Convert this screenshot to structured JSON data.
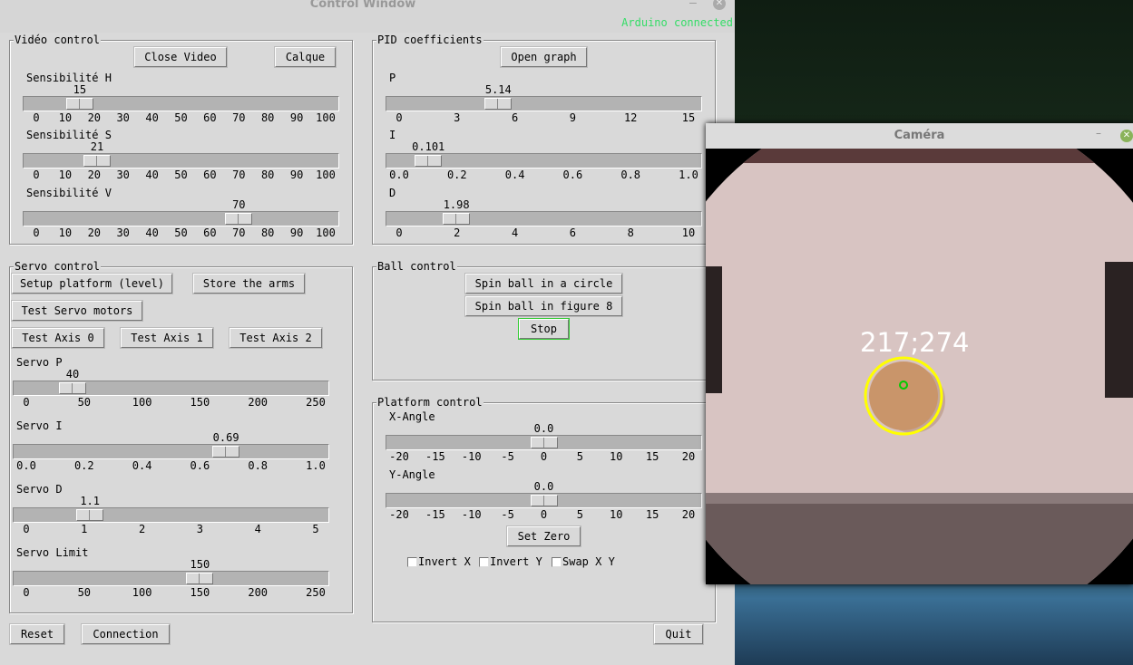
{
  "background": {
    "accent": "#33dd66"
  },
  "control_window": {
    "title": "Control Window",
    "status": "Arduino connected",
    "video": {
      "legend": "Vidéo control",
      "close_video": "Close Video",
      "calque": "Calque",
      "sliders": [
        {
          "label": "Sensibilité H",
          "value": 15,
          "display": "15",
          "min": 0,
          "max": 100,
          "ticks": [
            "0",
            "10",
            "20",
            "30",
            "40",
            "50",
            "60",
            "70",
            "80",
            "90",
            "100"
          ]
        },
        {
          "label": "Sensibilité S",
          "value": 21,
          "display": "21",
          "min": 0,
          "max": 100,
          "ticks": [
            "0",
            "10",
            "20",
            "30",
            "40",
            "50",
            "60",
            "70",
            "80",
            "90",
            "100"
          ]
        },
        {
          "label": "Sensibilité V",
          "value": 70,
          "display": "70",
          "min": 0,
          "max": 100,
          "ticks": [
            "0",
            "10",
            "20",
            "30",
            "40",
            "50",
            "60",
            "70",
            "80",
            "90",
            "100"
          ]
        }
      ]
    },
    "pid": {
      "legend": "PID coefficients",
      "open_graph": "Open graph",
      "sliders": [
        {
          "label": "P",
          "value": 5.14,
          "display": "5.14",
          "min": 0,
          "max": 15,
          "ticks": [
            "0",
            "3",
            "6",
            "9",
            "12",
            "15"
          ]
        },
        {
          "label": "I",
          "value": 0.101,
          "display": "0.101",
          "min": 0,
          "max": 1,
          "ticks": [
            "0.0",
            "0.2",
            "0.4",
            "0.6",
            "0.8",
            "1.0"
          ]
        },
        {
          "label": "D",
          "value": 1.98,
          "display": "1.98",
          "min": 0,
          "max": 10,
          "ticks": [
            "0",
            "2",
            "4",
            "6",
            "8",
            "10"
          ]
        }
      ]
    },
    "servo": {
      "legend": "Servo control",
      "setup_platform": "Setup platform (level)",
      "store_arms": "Store the arms",
      "test_servo": "Test Servo motors",
      "test_axis_0": "Test Axis 0",
      "test_axis_1": "Test Axis 1",
      "test_axis_2": "Test Axis 2",
      "sliders": [
        {
          "label": "Servo P",
          "value": 40,
          "display": "40",
          "min": 0,
          "max": 250,
          "ticks": [
            "0",
            "50",
            "100",
            "150",
            "200",
            "250"
          ]
        },
        {
          "label": "Servo I",
          "value": 0.69,
          "display": "0.69",
          "min": 0,
          "max": 1,
          "ticks": [
            "0.0",
            "0.2",
            "0.4",
            "0.6",
            "0.8",
            "1.0"
          ]
        },
        {
          "label": "Servo D",
          "value": 1.1,
          "display": "1.1",
          "min": 0,
          "max": 5,
          "ticks": [
            "0",
            "1",
            "2",
            "3",
            "4",
            "5"
          ]
        },
        {
          "label": "Servo Limit",
          "value": 150,
          "display": "150",
          "min": 0,
          "max": 250,
          "ticks": [
            "0",
            "50",
            "100",
            "150",
            "200",
            "250"
          ]
        }
      ]
    },
    "ball": {
      "legend": "Ball control",
      "spin_circle": "Spin ball in a circle",
      "spin_figure8": "Spin ball in figure 8",
      "stop": "Stop"
    },
    "platform": {
      "legend": "Platform control",
      "sliders": [
        {
          "label": "X-Angle",
          "value": 0,
          "display": "0.0",
          "min": -20,
          "max": 20,
          "ticks": [
            "-20",
            "-15",
            "-10",
            "-5",
            "0",
            "5",
            "10",
            "15",
            "20"
          ]
        },
        {
          "label": "Y-Angle",
          "value": 0,
          "display": "0.0",
          "min": -20,
          "max": 20,
          "ticks": [
            "-20",
            "-15",
            "-10",
            "-5",
            "0",
            "5",
            "10",
            "15",
            "20"
          ]
        }
      ],
      "set_zero": "Set Zero",
      "checkboxes": [
        {
          "label": "Invert X",
          "checked": false
        },
        {
          "label": "Invert Y",
          "checked": false
        },
        {
          "label": "Swap X Y",
          "checked": false
        }
      ]
    },
    "reset": "Reset",
    "connection": "Connection",
    "quit": "Quit"
  },
  "camera_window": {
    "title": "Caméra",
    "ball_coords": "217;274",
    "ball_circle_color": "#ffff00",
    "center_marker_color": "#00cc00"
  }
}
